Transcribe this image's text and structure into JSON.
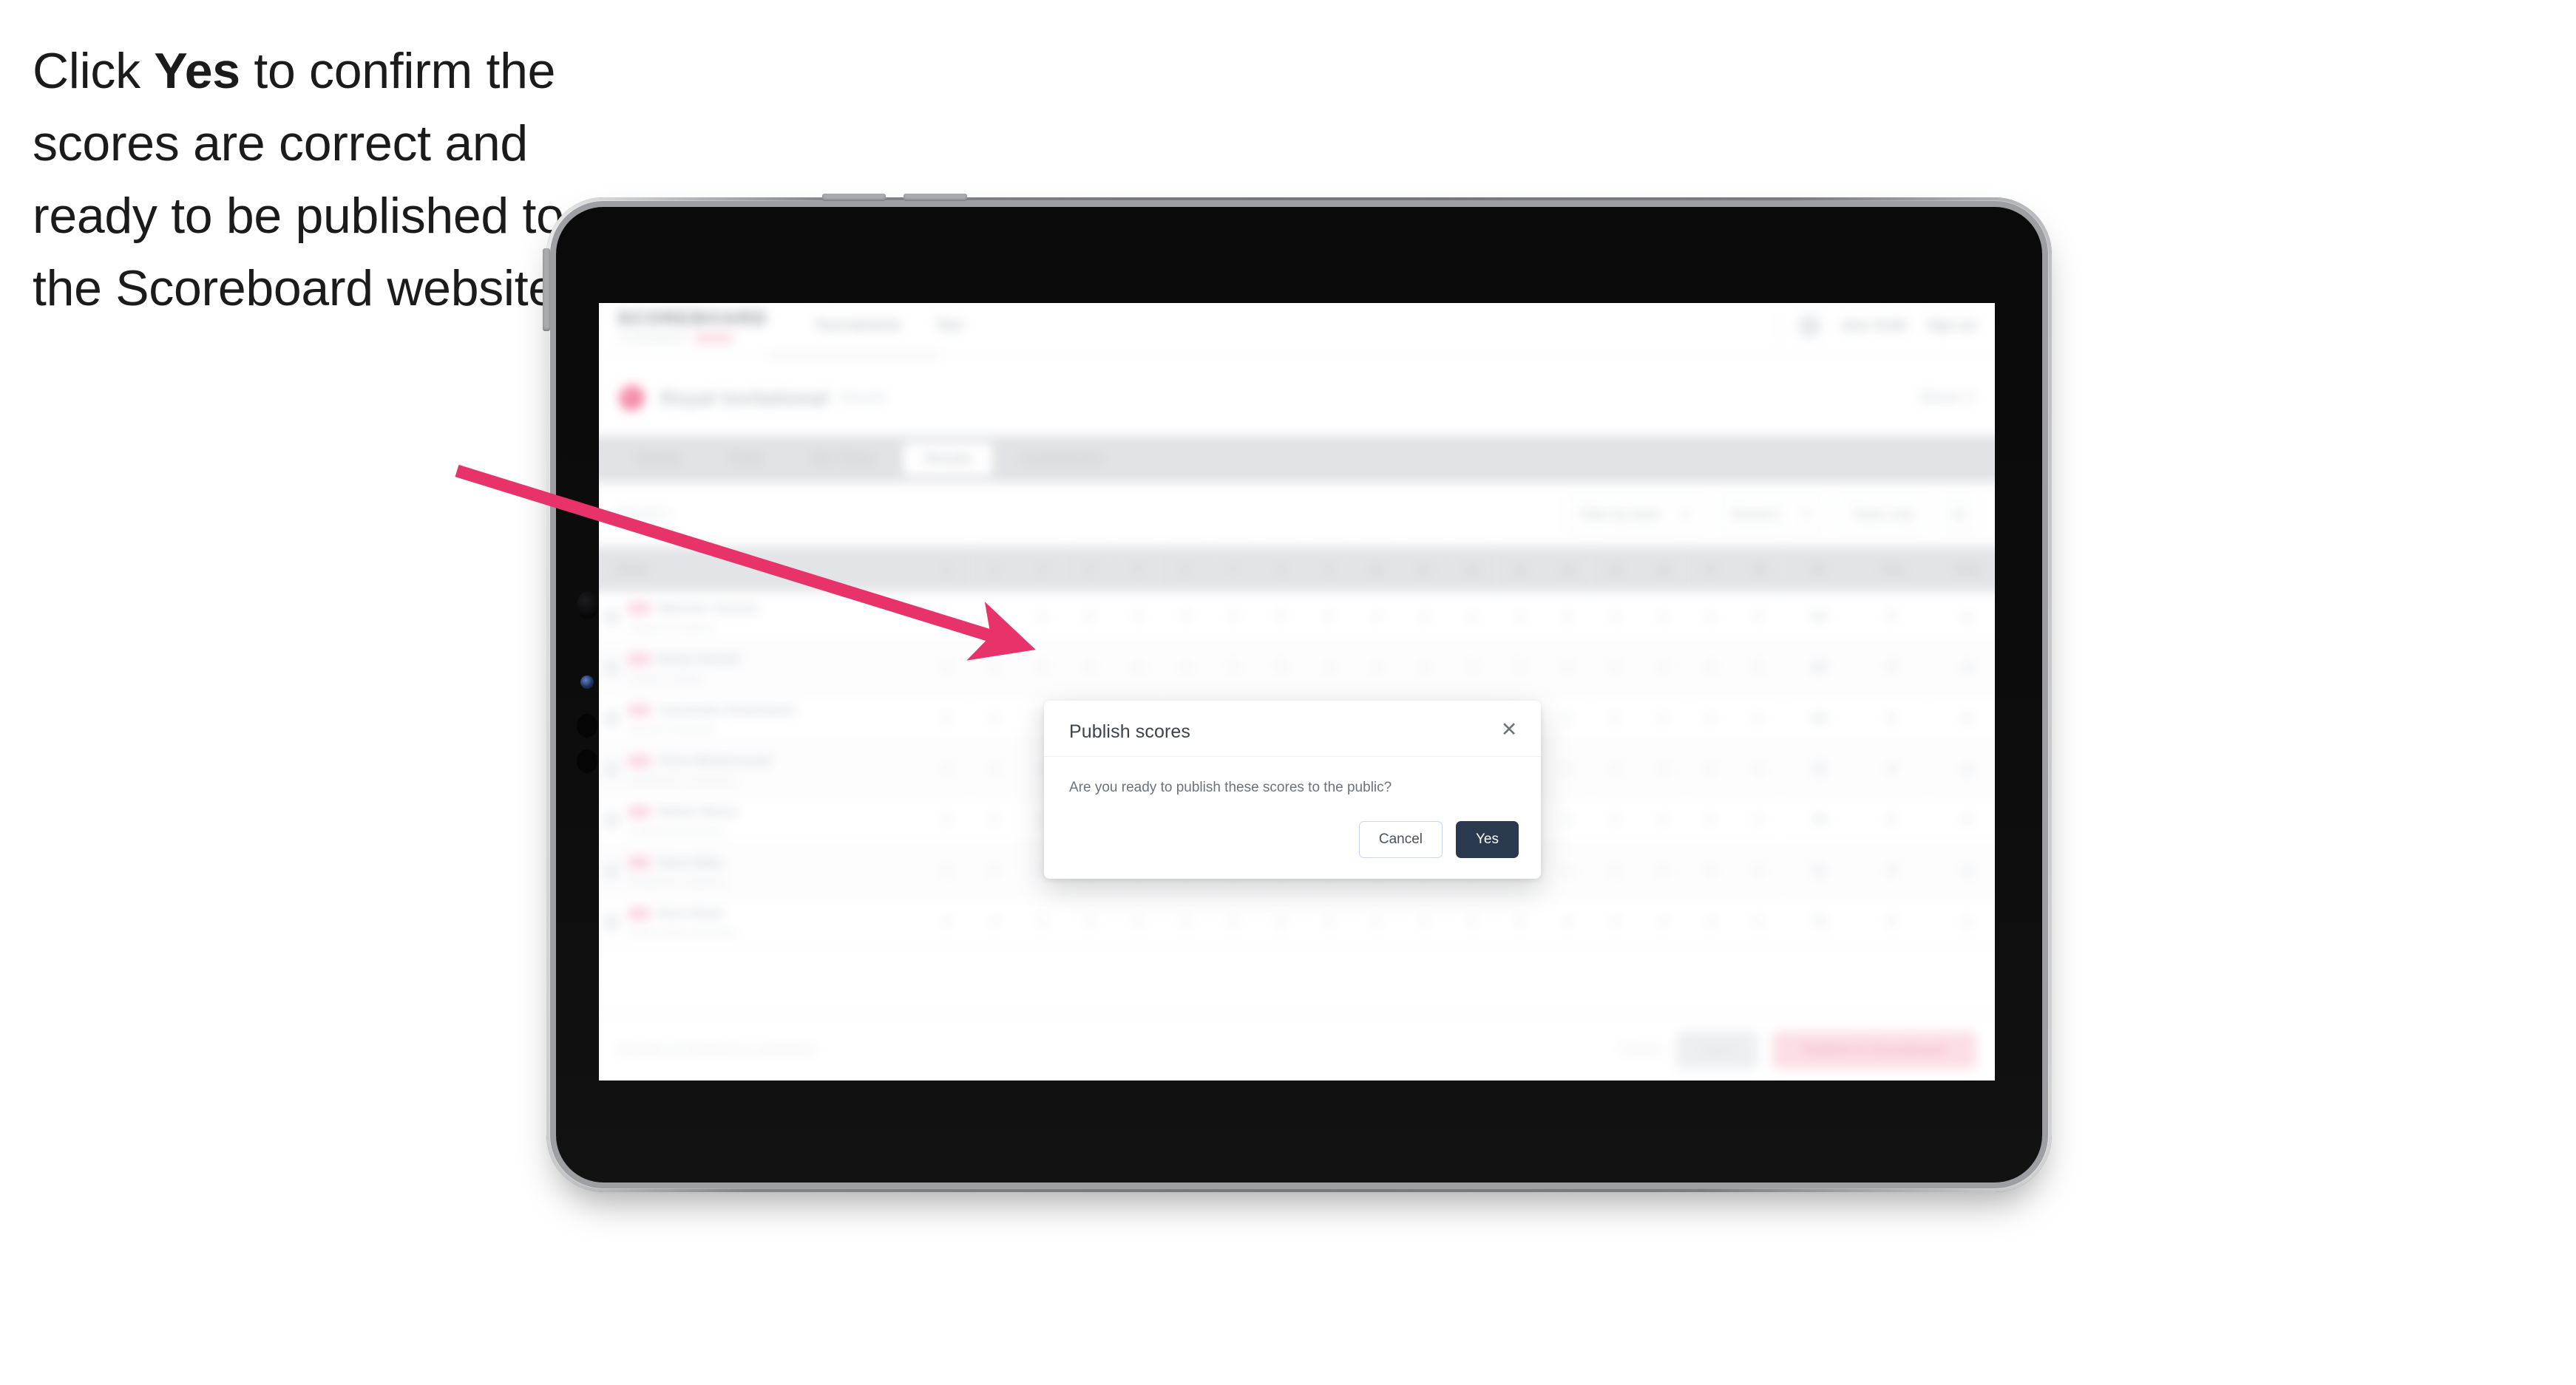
{
  "caption": {
    "before": "Click ",
    "bold": "Yes",
    "after": " to confirm the scores are correct and ready to be published to the Scoreboard website."
  },
  "annotation": {
    "arrow_color": "#e8336a",
    "points_to": "yes-button"
  },
  "device": {
    "type": "tablet",
    "frame_color": "#0d0d0d",
    "rail_color": "#9d9fa3"
  },
  "app": {
    "brand": {
      "word": "SCOREBOARD",
      "tagline": "TOURNAMENT"
    },
    "top_nav": [
      {
        "label": "Tournaments"
      },
      {
        "label": "Tour"
      }
    ],
    "top_right": [
      {
        "label": "Jane Smith"
      },
      {
        "label": "Sign out"
      }
    ],
    "title_row": {
      "title": "Royal Invitational",
      "subtitle": "Round",
      "right_label": "Week 3"
    },
    "tabs": [
      {
        "label": "Details",
        "active": false
      },
      {
        "label": "Field",
        "active": false
      },
      {
        "label": "Tee Times",
        "active": false
      },
      {
        "label": "Results",
        "active": true
      },
      {
        "label": "Leaderboard",
        "active": false
      }
    ],
    "toolbar": {
      "left_label": "Round 1",
      "filters": [
        {
          "label": "Filter by team"
        },
        {
          "label": "Round 1"
        },
        {
          "label": "Team only"
        }
      ],
      "icon_button": "settings-icon"
    },
    "table": {
      "headers_player": "Player",
      "headers_holes": [
        "1",
        "2",
        "3",
        "4",
        "5",
        "6",
        "7",
        "8",
        "9",
        "10",
        "11",
        "12",
        "13",
        "14",
        "15",
        "16",
        "17",
        "18"
      ],
      "headers_tail": [
        "R1",
        "Thru",
        "Total"
      ],
      "rows": [
        {
          "rank": "T1",
          "name": "Malcolm Torrens",
          "meta": "Regional Academy",
          "holes": [
            "4",
            "4",
            "3",
            "5",
            "4",
            "3",
            "4",
            "5",
            "4",
            "4",
            "3",
            "4",
            "4",
            "5",
            "3",
            "4",
            "4",
            "5"
          ],
          "tail": [
            "68",
            "F",
            "-4",
            "-4"
          ]
        },
        {
          "rank": "T1",
          "name": "Ethan Parnell",
          "meta": "Coastal College",
          "holes": [
            "4",
            "5",
            "3",
            "4",
            "4",
            "4",
            "3",
            "5",
            "4",
            "4",
            "4",
            "3",
            "5",
            "4",
            "4",
            "4",
            "3",
            "5"
          ],
          "tail": [
            "68",
            "F",
            "-4",
            "-4"
          ]
        },
        {
          "rank": "3",
          "name": "Cassandra Rodenbach",
          "meta": "Hillcrest University",
          "holes": [
            "5",
            "4",
            "3",
            "4",
            "5",
            "4",
            "4",
            "4",
            "3",
            "5",
            "4",
            "4",
            "3",
            "4",
            "5",
            "4",
            "4",
            "4"
          ],
          "tail": [
            "69",
            "F",
            "-3",
            "-3"
          ]
        },
        {
          "rank": "T4",
          "name": "Chris Westermund",
          "meta": "Northwood Community",
          "holes": [
            "4",
            "4",
            "4",
            "5",
            "3",
            "4",
            "4",
            "4",
            "5",
            "4",
            "3",
            "4",
            "4",
            "5",
            "4",
            "3",
            "4",
            "4"
          ],
          "tail": [
            "70",
            "F",
            "-2",
            "-2"
          ]
        },
        {
          "rank": "T4",
          "name": "Robert Baum",
          "meta": "Southland University",
          "holes": [
            "4",
            "5",
            "4",
            "4",
            "3",
            "5",
            "4",
            "4",
            "4",
            "4",
            "5",
            "3",
            "4",
            "4",
            "4",
            "4",
            "5",
            "3"
          ],
          "tail": [
            "70",
            "F",
            "-2",
            "-2"
          ]
        },
        {
          "rank": "T6",
          "name": "Dane Mitta",
          "meta": "Westbrook Academy",
          "holes": [
            "5",
            "4",
            "4",
            "4",
            "4",
            "4",
            "5",
            "3",
            "4",
            "5",
            "4",
            "4",
            "4",
            "3",
            "5",
            "4",
            "4",
            "4"
          ],
          "tail": [
            "71",
            "F",
            "-1",
            "-1"
          ]
        },
        {
          "rank": "T6",
          "name": "Nick Nolan",
          "meta": "Grand Lakes University",
          "holes": [
            "4",
            "4",
            "5",
            "4",
            "4",
            "3",
            "4",
            "5",
            "4",
            "4",
            "4",
            "4",
            "5",
            "4",
            "3",
            "4",
            "4",
            "5"
          ],
          "tail": [
            "71",
            "F",
            "-1",
            "-1"
          ]
        }
      ]
    },
    "footer": {
      "note": "Results not finalised or published",
      "text_action": "Cancel",
      "secondary_action": "Save",
      "primary_action": "Publish to Scoreboard"
    }
  },
  "dialog": {
    "title": "Publish scores",
    "close_icon": "close-icon",
    "body": "Are you ready to publish these scores to the public?",
    "cancel_label": "Cancel",
    "confirm_label": "Yes",
    "confirm_bg": "#2b394e"
  }
}
